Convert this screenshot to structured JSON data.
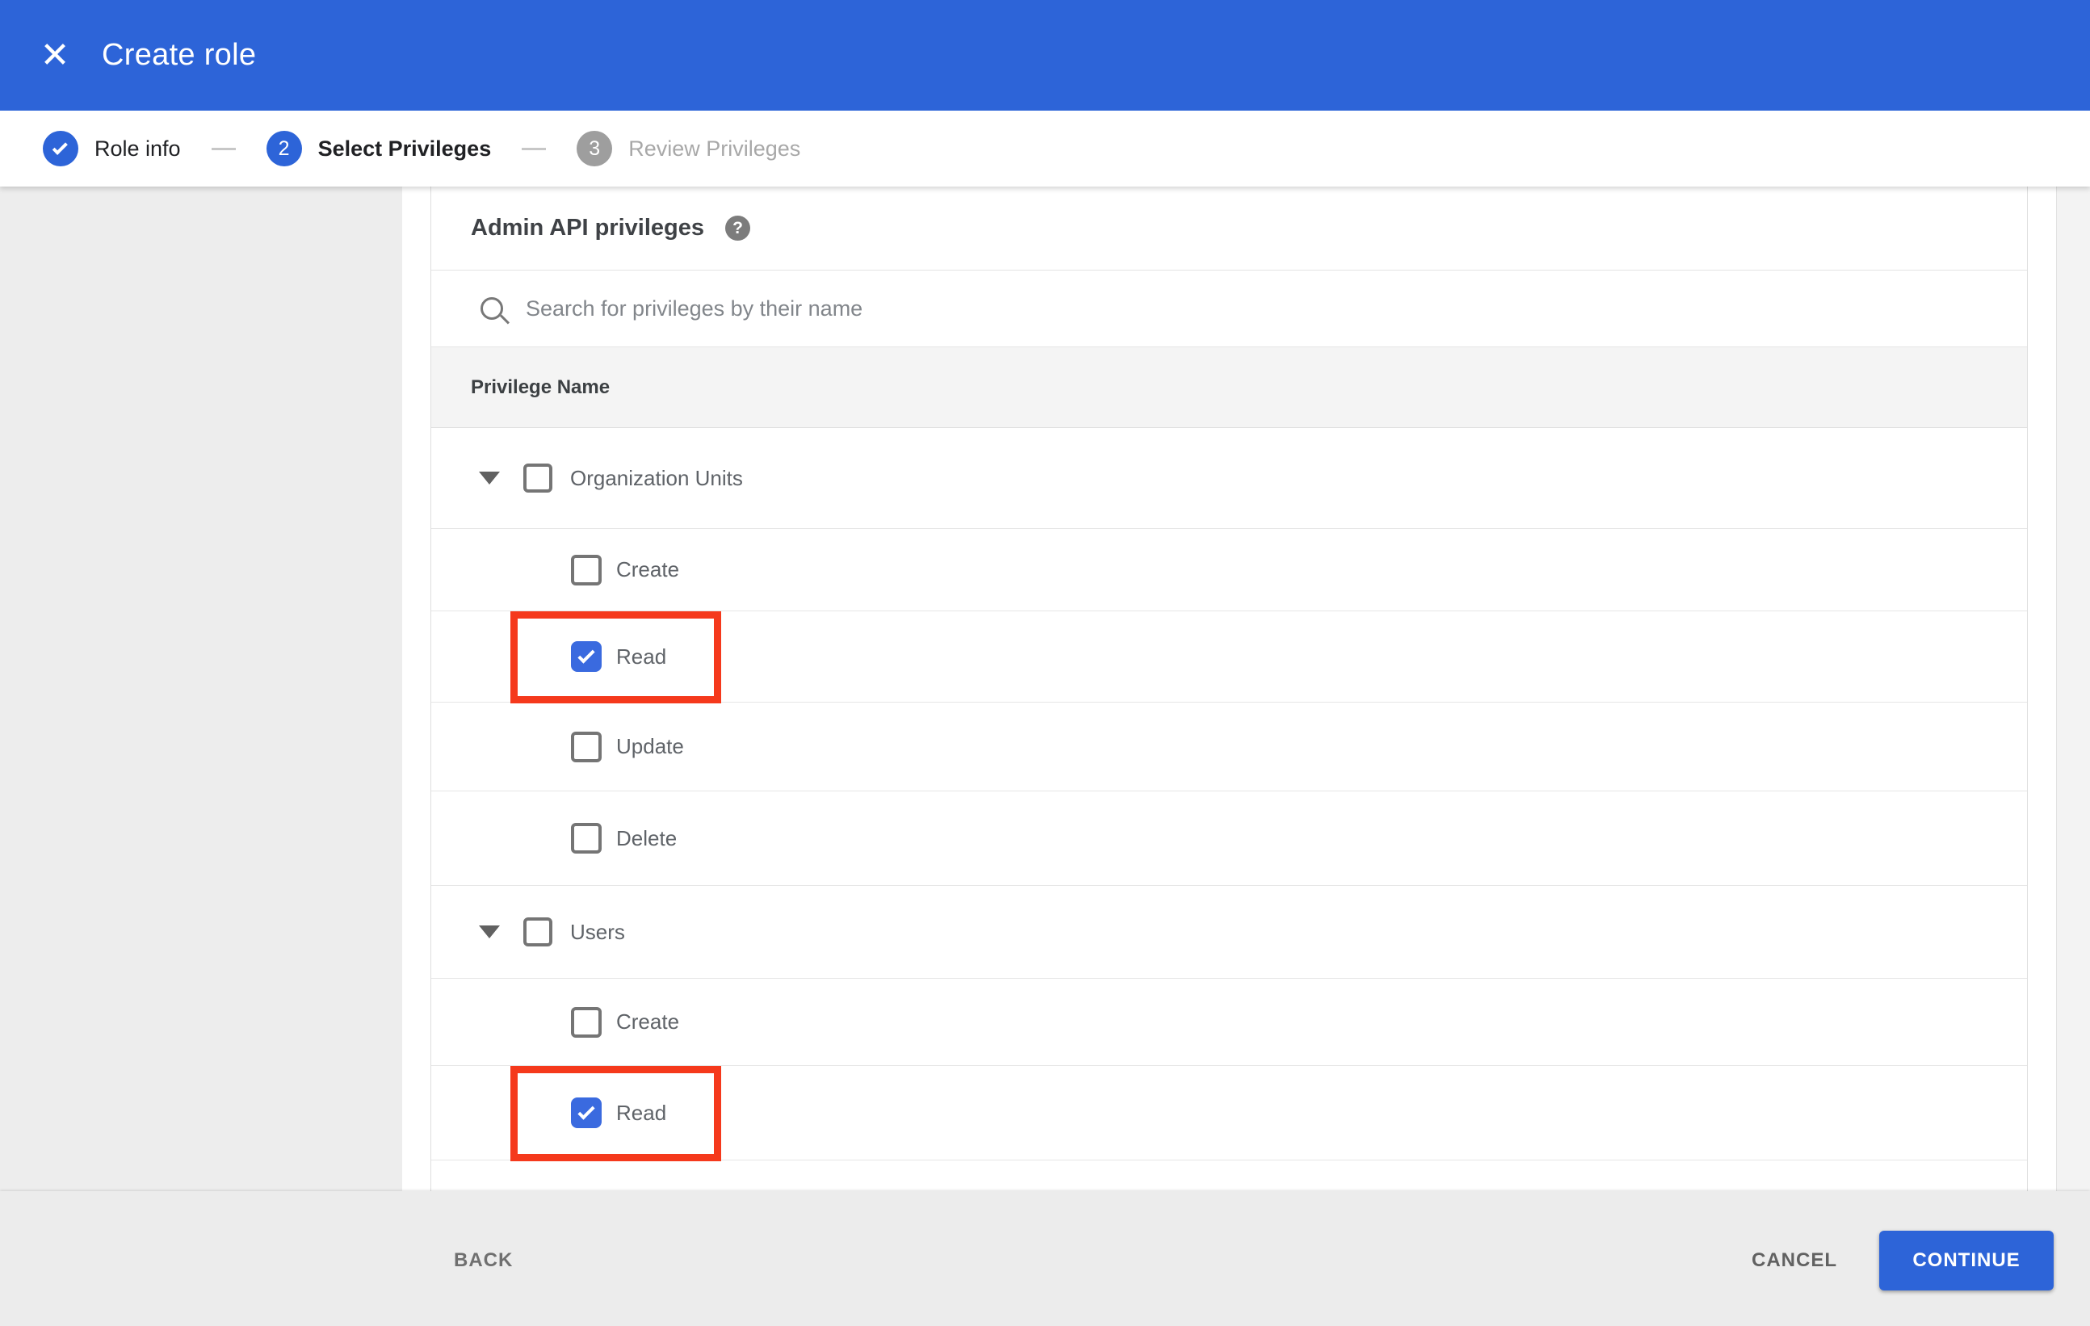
{
  "header": {
    "title": "Create role"
  },
  "icons": {
    "close": "✕",
    "help": "?",
    "search": "search-magnifier",
    "expand": "triangle-down"
  },
  "stepper": {
    "steps": [
      {
        "indicator": "check",
        "label": "Role info",
        "state": "completed"
      },
      {
        "indicator": "2",
        "label": "Select Privileges",
        "state": "active"
      },
      {
        "indicator": "3",
        "label": "Review Privileges",
        "state": "upcoming"
      }
    ]
  },
  "panel": {
    "title": "Admin API privileges",
    "search": {
      "placeholder": "Search for privileges by their name",
      "value": ""
    },
    "table": {
      "column_header": "Privilege Name",
      "rows": [
        {
          "type": "parent",
          "label": "Organization Units",
          "checked": false,
          "expanded": true,
          "highlighted": false
        },
        {
          "type": "child",
          "label": "Create",
          "checked": false,
          "highlighted": false
        },
        {
          "type": "child",
          "label": "Read",
          "checked": true,
          "highlighted": true
        },
        {
          "type": "child",
          "label": "Update",
          "checked": false,
          "highlighted": false
        },
        {
          "type": "child",
          "label": "Delete",
          "checked": false,
          "highlighted": false
        },
        {
          "type": "parent",
          "label": "Users",
          "checked": false,
          "expanded": true,
          "highlighted": false
        },
        {
          "type": "child",
          "label": "Create",
          "checked": false,
          "highlighted": false
        },
        {
          "type": "child",
          "label": "Read",
          "checked": true,
          "highlighted": true
        }
      ]
    }
  },
  "footer": {
    "back": "BACK",
    "cancel": "CANCEL",
    "continue": "CONTINUE"
  },
  "colors": {
    "header_blue": "#2d64d8",
    "checkbox_blue": "#3a6adf",
    "annotation_red": "#f5391c",
    "footer_gray": "#ececec",
    "table_header_gray": "#f4f4f4"
  }
}
